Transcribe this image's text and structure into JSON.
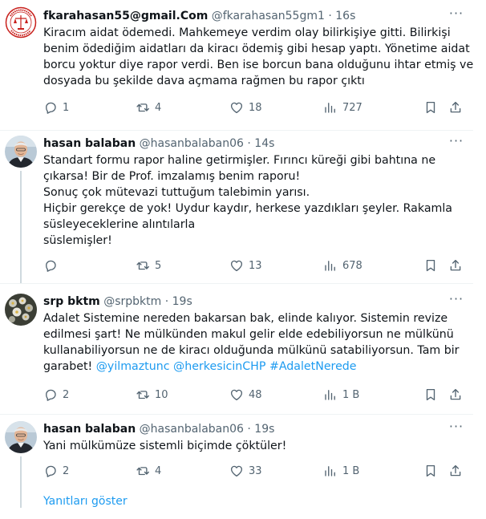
{
  "tweets": [
    {
      "name": "fkarahasan55@gmail.Com",
      "handle": "@fkarahasan55gm1",
      "separator": "·",
      "time": "16s",
      "avatar_icon": "seal-avatar",
      "lines": [
        "Kiracım aidat ödemedi. Mahkemeye verdim olay bilirkişiye gitti. Bilirkişi",
        "benim ödediğim aidatları da kiracı ödemiş gibi hesap yaptı. Yönetime aidat",
        "borcu yoktur diye rapor verdi. Ben ise borcun bana olduğunu ihtar etmiş ve",
        "dosyada bu şekilde dava açmama rağmen bu rapor çıktı"
      ],
      "replies": "1",
      "retweets": "4",
      "likes": "18",
      "views": "727"
    },
    {
      "name": "hasan balaban",
      "handle": "@hasanbalaban06",
      "separator": "·",
      "time": "14s",
      "avatar_icon": "person-avatar",
      "lines": [
        "Standart formu rapor haline getirmişler. Fırıncı küreği gibi bahtına ne",
        "çıkarsa! Bir de Prof. imzalamış benim raporu!",
        "Sonuç çok mütevazi tuttuğum talebimin yarısı.",
        "Hiçbir gerekçe de yok! Uydur kaydır, herkese yazdıkları şeyler. Rakamla",
        "süsleyeceklerine alıntılarla",
        "süslemişler!"
      ],
      "replies": "",
      "retweets": "5",
      "likes": "13",
      "views": "678"
    },
    {
      "name": "srp bktm",
      "handle": "@srpbktm",
      "separator": "·",
      "time": "19s",
      "avatar_icon": "flower-avatar",
      "lines": [
        "Adalet Sistemine nereden bakarsan bak, elinde kalıyor. Sistemin revize",
        "edilmesi şart! Ne mülkünden makul gelir elde edebiliyorsun ne mülkünü",
        "kullanabiliyorsun ne de kiracı olduğunda mülkünü satabiliyorsun. Tam bir"
      ],
      "last_line_text": "garabet! ",
      "mentions": [
        "@yilmaztunc",
        "@herkesicinCHP",
        "#AdaletNerede"
      ],
      "replies": "2",
      "retweets": "10",
      "likes": "48",
      "views": "1 B"
    },
    {
      "name": "hasan balaban",
      "handle": "@hasanbalaban06",
      "separator": "·",
      "time": "19s",
      "avatar_icon": "person-avatar",
      "lines": [
        "Yani mülkümüze sistemli biçimde çöktüler!"
      ],
      "replies": "2",
      "retweets": "4",
      "likes": "33",
      "views": "1 B"
    }
  ],
  "more_glyph": "···",
  "show_replies": "Yanıtları göster",
  "colors": {
    "accent": "#1d9bf0",
    "secondary_text": "#536471",
    "divider": "#eff3f4",
    "thread_line": "#cfd9de"
  }
}
